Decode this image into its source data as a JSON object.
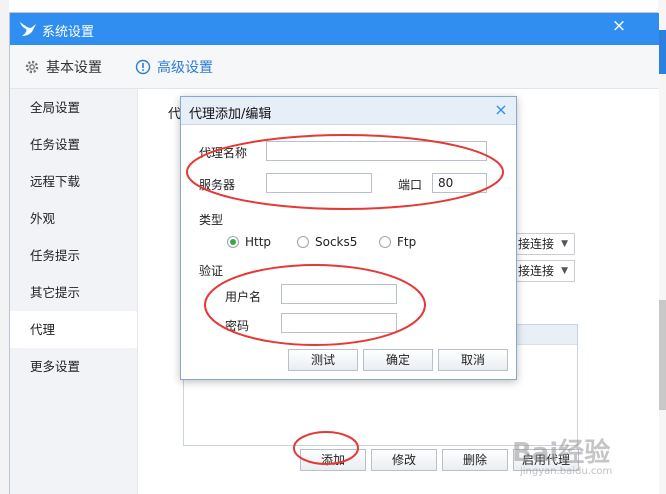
{
  "window": {
    "title": "系统设置",
    "close_glyph": "×"
  },
  "tabs": [
    {
      "label": "基本设置",
      "icon": "gear-icon"
    },
    {
      "label": "高级设置",
      "icon": "info-circle-icon",
      "active_color": "#2f7bd6"
    }
  ],
  "sidebar": {
    "items": [
      {
        "label": "全局设置"
      },
      {
        "label": "任务设置"
      },
      {
        "label": "远程下载"
      },
      {
        "label": "外观"
      },
      {
        "label": "任务提示"
      },
      {
        "label": "其它提示"
      },
      {
        "label": "代理"
      },
      {
        "label": "更多设置"
      }
    ],
    "active_index": 6
  },
  "content": {
    "heading_partial": "代",
    "select1_value": "接连接",
    "select2_value": "接连接",
    "buttons": {
      "add": "添加",
      "modify": "修改",
      "delete": "删除",
      "enable": "启用代理"
    }
  },
  "dialog": {
    "title": "代理添加/编辑",
    "close_glyph": "×",
    "proxy_name_label": "代理名称",
    "proxy_name_value": "",
    "server_label": "服务器",
    "server_value": "",
    "port_label": "端口",
    "port_value": "80",
    "type_label": "类型",
    "types": [
      {
        "label": "Http",
        "selected": true
      },
      {
        "label": "Socks5",
        "selected": false
      },
      {
        "label": "Ftp",
        "selected": false
      }
    ],
    "auth_label": "验证",
    "username_label": "用户名",
    "username_value": "",
    "password_label": "密码",
    "password_value": "",
    "buttons": {
      "test": "测试",
      "ok": "确定",
      "cancel": "取消"
    }
  },
  "watermark": {
    "text": "Bai经验",
    "sub": "jingyan.baidu.com"
  },
  "colors": {
    "accent": "#2f8ef0",
    "annotation": "#e53935",
    "radio_on": "#3aa845"
  }
}
